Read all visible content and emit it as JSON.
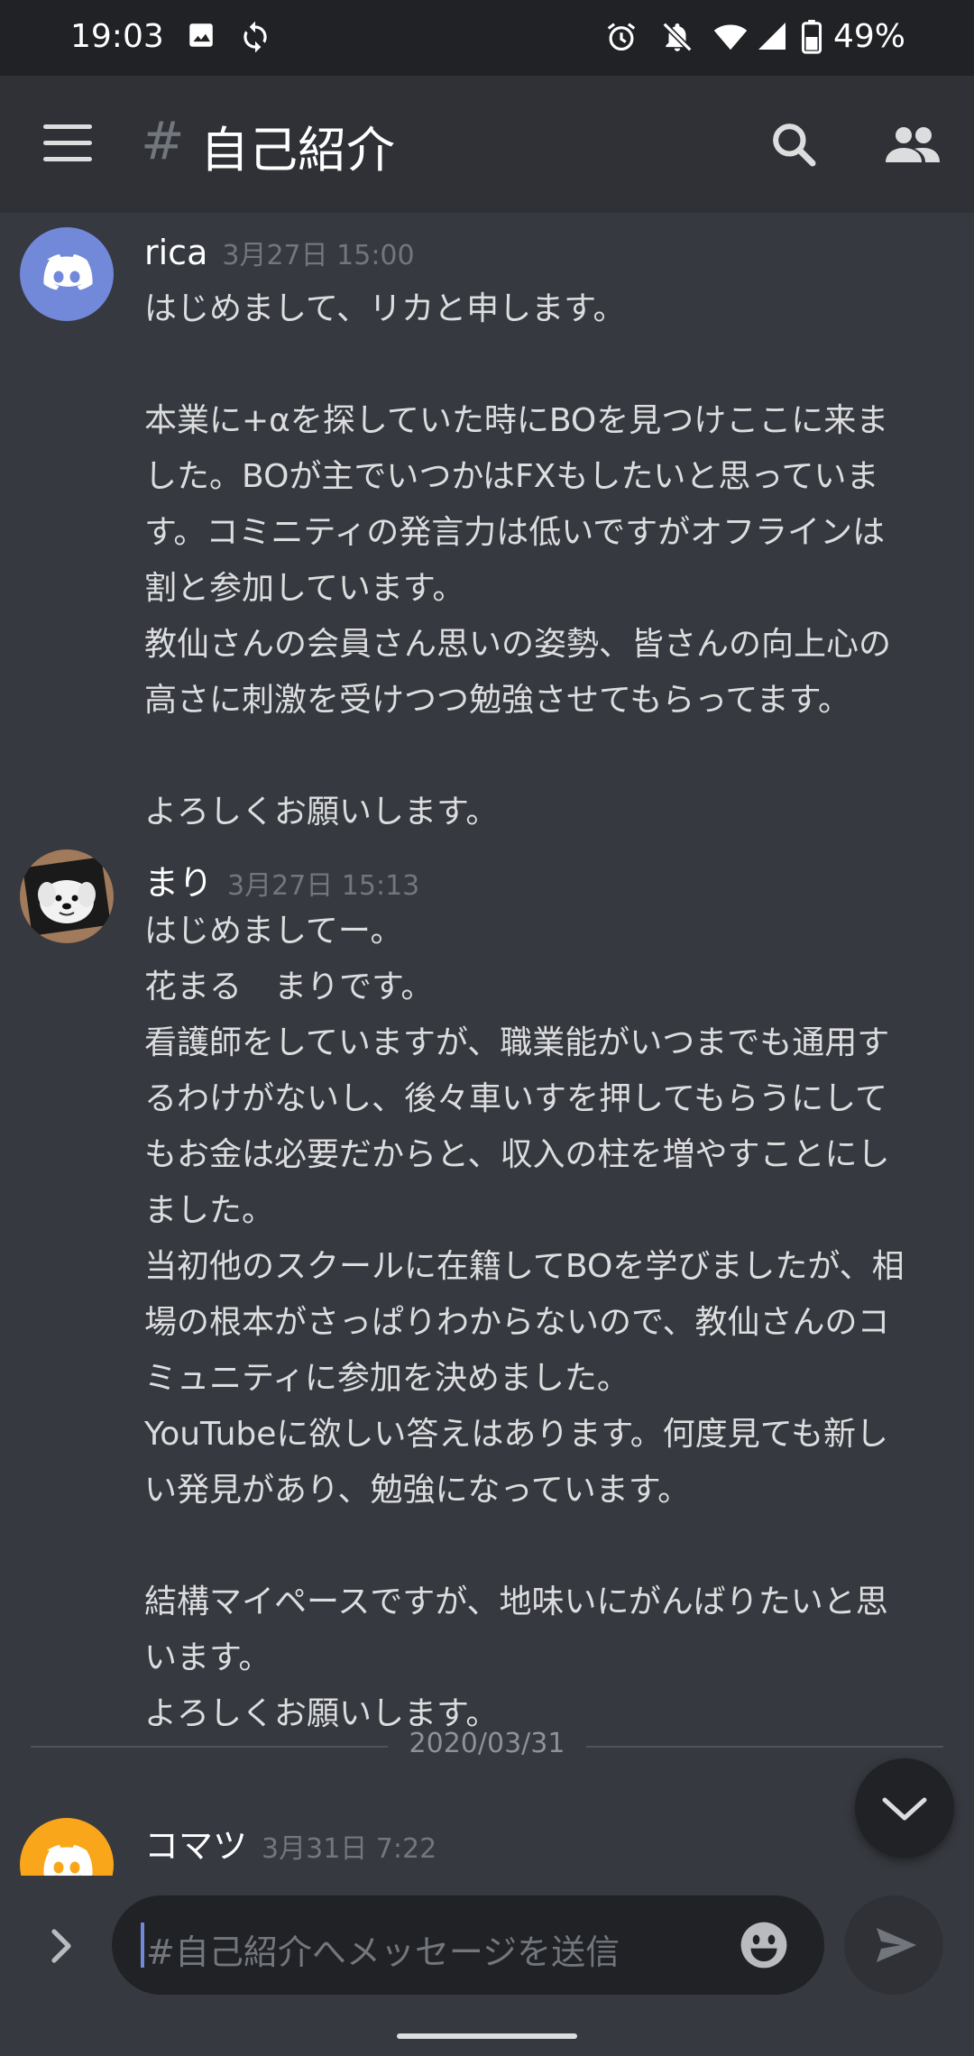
{
  "status_bar": {
    "time": "19:03",
    "battery_percent": "49%",
    "icons": [
      "image-icon",
      "sync-icon",
      "alarm-icon",
      "notifications-off-icon",
      "wifi-icon",
      "cellular-signal-icon",
      "battery-icon"
    ]
  },
  "app_bar": {
    "hash": "#",
    "channel_name": "自己紹介",
    "icons": [
      "menu-icon",
      "search-icon",
      "members-icon"
    ]
  },
  "colors": {
    "background": "#36393f",
    "header": "#2f3136",
    "input": "#202225",
    "blurple": "#7289da",
    "orange": "#faa61a"
  },
  "messages": [
    {
      "author": "rica",
      "timestamp": "3月27日 15:00",
      "avatar": "discord-logo-blurple",
      "lines": [
        "はじめまして、リカと申します。",
        "",
        "本業に+αを探していた時にBOを見つけここに来ま",
        "した。BOが主でいつかはFXもしたいと思っていま",
        "す。コミニティの発言力は低いですがオフラインは",
        "割と参加しています。",
        "教仙さんの会員さん思いの姿勢、皆さんの向上心の",
        "高さに刺激を受けつつ勉強させてもらってます。",
        "",
        "よろしくお願いします。"
      ]
    },
    {
      "author": "まり",
      "timestamp": "3月27日 15:13",
      "avatar": "dog-photo",
      "lines": [
        "はじめましてー。",
        "花まる　まりです。",
        "看護師をしていますが、職業能がいつまでも通用す",
        "るわけがないし、後々車いすを押してもらうにして",
        "もお金は必要だからと、収入の柱を増やすことにし",
        "ました。",
        "当初他のスクールに在籍してBOを学びましたが、相",
        "場の根本がさっぱりわからないので、教仙さんのコ",
        "ミュニティに参加を決めました。",
        "YouTubeに欲しい答えはあります。何度見ても新し",
        "い発見があり、勉強になっています。",
        "",
        "結構マイペースですが、地味いにがんばりたいと思",
        "います。",
        "よろしくお願いします。"
      ]
    },
    {
      "author": "コマツ",
      "timestamp": "3月31日 7:22",
      "avatar": "discord-logo-orange",
      "lines": []
    }
  ],
  "date_divider": "2020/03/31",
  "composer": {
    "placeholder": "#自己紹介へメッセージを送信",
    "icons": [
      "expand-chevron-icon",
      "emoji-icon",
      "send-icon"
    ]
  },
  "scroll_button_icon": "chevron-down-icon"
}
